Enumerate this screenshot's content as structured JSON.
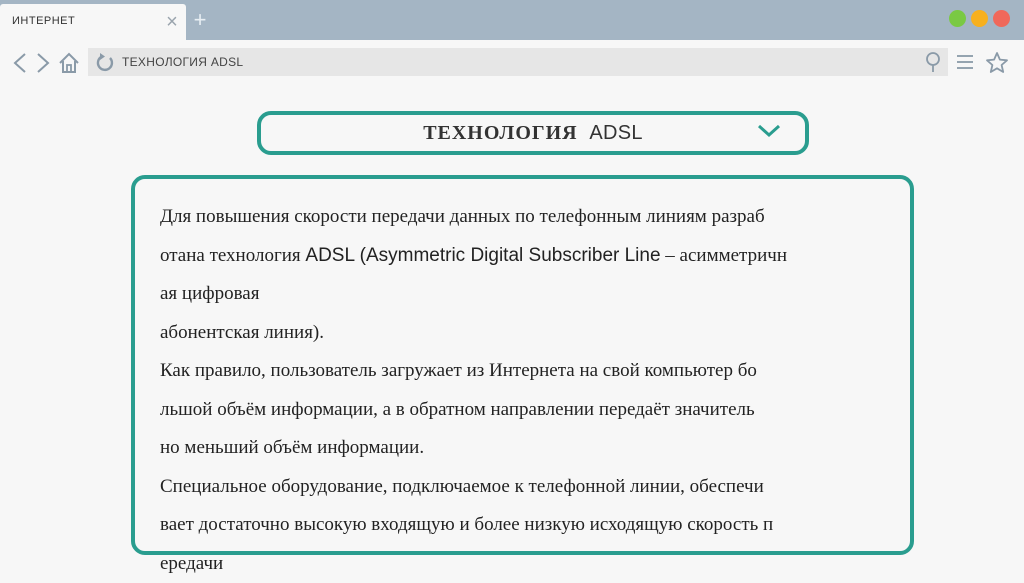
{
  "browser": {
    "tab_title": "ИНТЕРНЕТ",
    "tab_close": "×",
    "new_tab": "+",
    "address_text": "ТЕХНОЛОГИЯ  ADSL"
  },
  "colors": {
    "accent": "#2a9d8f",
    "titlebar": "#a4b5c4",
    "win_green": "#7ac943",
    "win_yellow": "#f7b01e",
    "win_red": "#f0685a"
  },
  "icons": {
    "back": "chevron-left-icon",
    "forward": "chevron-right-icon",
    "home": "home-icon",
    "reload": "reload-icon",
    "search": "search-icon",
    "menu": "hamburger-menu-icon",
    "bookmark": "star-icon",
    "dropdown": "chevron-down-icon"
  },
  "heading": {
    "word1": "ТЕХНОЛОГИЯ",
    "word2": "ADSL"
  },
  "content": {
    "l1": "Для повышения скорости передачи данных по телефонным линиям разраб",
    "l2a": "отана технология ",
    "l2b": "ADSL (Asymmetric Digital Subscriber Line",
    "l2c": " – асимметричн",
    "l3": "ая цифровая",
    "l4": "абонентская линия).",
    "l5": "Как правило, пользователь загружает из Интернета на свой компьютер бо",
    "l6": "льшой объём информации, а в обратном направлении передаёт значитель",
    "l7": "но меньший объём информации.",
    "l8": "Специальное оборудование, подключаемое к телефонной линии, обеспечи",
    "l9": "вает достаточно высокую входящую и более низкую исходящую скорость п",
    "l10": "ередачи"
  }
}
